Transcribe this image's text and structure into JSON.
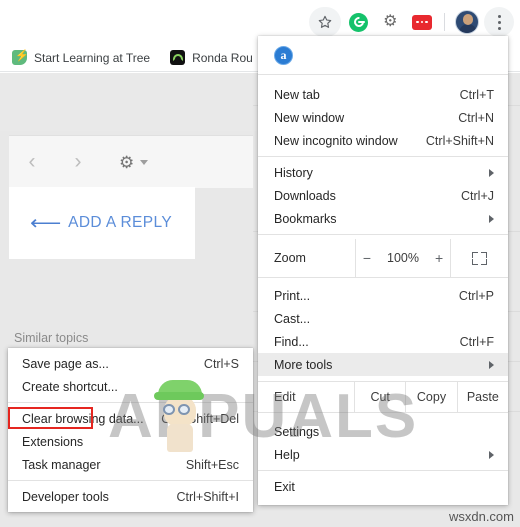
{
  "browser": {
    "toolbar": {
      "bookmark_star": "star-icon",
      "extensions": [
        {
          "name": "grammarly-extension-icon",
          "color": "#15c26b"
        },
        {
          "name": "gear-extension-icon",
          "color": "#6b6b6b"
        },
        {
          "name": "red-extension-icon",
          "color": "#e8292f"
        }
      ],
      "avatar": "profile-avatar",
      "menu_button": "three-dot-menu-icon"
    },
    "bookmarks": [
      {
        "label": "Start Learning at Tree",
        "icon": "treehouse-bookmark-icon"
      },
      {
        "label": "Ronda Rou",
        "icon": "ronda-bookmark-icon"
      }
    ]
  },
  "page": {
    "nav_prev": "‹",
    "nav_next": "›",
    "settings_gear": "gear-icon",
    "reply_button": "ADD A REPLY",
    "reply_arrow": "↖",
    "similar_topics": "Similar topics"
  },
  "menu": {
    "account_initial": "a",
    "groups": [
      {
        "items": [
          {
            "label": "New tab",
            "accel": "Ctrl+T",
            "submenu": false
          },
          {
            "label": "New window",
            "accel": "Ctrl+N",
            "submenu": false
          },
          {
            "label": "New incognito window",
            "accel": "Ctrl+Shift+N",
            "submenu": false
          }
        ]
      },
      {
        "items": [
          {
            "label": "History",
            "accel": "",
            "submenu": true
          },
          {
            "label": "Downloads",
            "accel": "Ctrl+J",
            "submenu": false
          },
          {
            "label": "Bookmarks",
            "accel": "",
            "submenu": true
          }
        ]
      }
    ],
    "zoom": {
      "label": "Zoom",
      "minus": "−",
      "level": "100%",
      "plus": "+",
      "fullscreen_icon": "fullscreen-icon"
    },
    "group3": [
      {
        "label": "Print...",
        "accel": "Ctrl+P",
        "submenu": false,
        "highlighted": false
      },
      {
        "label": "Cast...",
        "accel": "",
        "submenu": false,
        "highlighted": false
      },
      {
        "label": "Find...",
        "accel": "Ctrl+F",
        "submenu": false,
        "highlighted": false
      },
      {
        "label": "More tools",
        "accel": "",
        "submenu": true,
        "highlighted": true
      }
    ],
    "edit_row": {
      "label": "Edit",
      "cut": "Cut",
      "copy": "Copy",
      "paste": "Paste"
    },
    "group4": [
      {
        "label": "Settings",
        "accel": "",
        "submenu": false
      },
      {
        "label": "Help",
        "accel": "",
        "submenu": true
      }
    ],
    "group5": [
      {
        "label": "Exit",
        "accel": "",
        "submenu": false
      }
    ]
  },
  "submenu": {
    "title": "More tools",
    "groups": [
      {
        "items": [
          {
            "label": "Save page as...",
            "accel": "Ctrl+S",
            "highlighted": false
          },
          {
            "label": "Create shortcut...",
            "accel": "",
            "highlighted": false
          }
        ]
      },
      {
        "items": [
          {
            "label": "Clear browsing data...",
            "accel": "Ctrl+Shift+Del",
            "highlighted": false
          },
          {
            "label": "Extensions",
            "accel": "",
            "highlighted": true
          },
          {
            "label": "Task manager",
            "accel": "Shift+Esc",
            "highlighted": false
          }
        ]
      },
      {
        "items": [
          {
            "label": "Developer tools",
            "accel": "Ctrl+Shift+I",
            "highlighted": false
          }
        ]
      }
    ]
  },
  "watermark": {
    "brand": "APPUALS",
    "source": "wsxdn.com"
  },
  "colors": {
    "highlight_red": "#e52620",
    "link_blue": "#5b8dd9",
    "menu_highlight": "#ebebeb"
  }
}
